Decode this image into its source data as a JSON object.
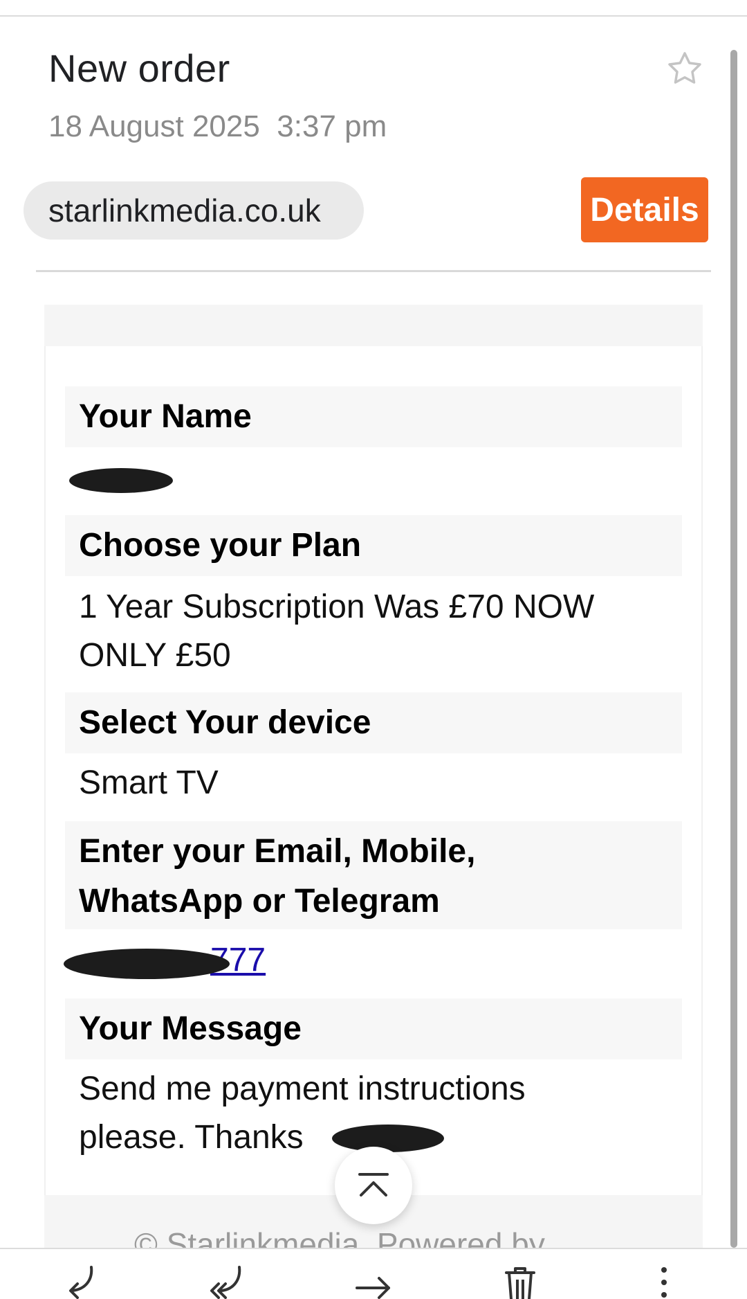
{
  "email": {
    "subject": "New order",
    "date": "18 August 2025",
    "time": "3:37 pm",
    "sender": "starlinkmedia.co.uk",
    "details_label": "Details"
  },
  "form": {
    "fields": [
      {
        "label": "Your Name",
        "value": ""
      },
      {
        "label": "Choose your Plan",
        "value_line1": "1 Year Subscription Was £70 NOW",
        "value_line2": "ONLY £50"
      },
      {
        "label": "Select Your device",
        "value": "Smart TV"
      },
      {
        "label_line1": "Enter your Email, Mobile,",
        "label_line2": "WhatsApp or Telegram",
        "value": "777"
      },
      {
        "label": "Your Message",
        "value_line1": "Send me payment instructions",
        "value_line2": "please. Thanks"
      }
    ]
  },
  "footer": {
    "text": "© Starlinkmedia. Powered by"
  },
  "toolbar": {
    "icons": [
      "reply-icon",
      "reply-all-icon",
      "forward-icon",
      "delete-icon",
      "more-icon"
    ]
  },
  "colors": {
    "accent": "#f26722",
    "link": "#1a0dab",
    "label_bg": "#f7f7f7"
  }
}
